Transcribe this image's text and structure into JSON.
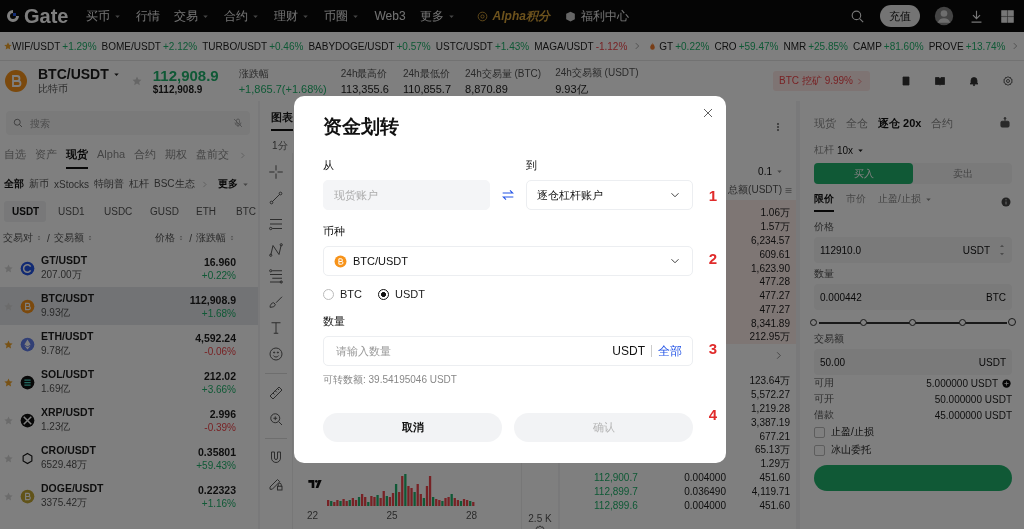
{
  "nav": {
    "logo": "Gate",
    "menu": [
      {
        "label": "买币",
        "dropdown": true,
        "kind": "plain"
      },
      {
        "label": "行情",
        "dropdown": false,
        "kind": "plain"
      },
      {
        "label": "交易",
        "dropdown": true,
        "kind": "plain"
      },
      {
        "label": "合约",
        "dropdown": true,
        "kind": "plain"
      },
      {
        "label": "理财",
        "dropdown": true,
        "kind": "plain"
      },
      {
        "label": "币圈",
        "dropdown": true,
        "kind": "plain"
      },
      {
        "label": "Web3",
        "dropdown": false,
        "kind": "plain"
      },
      {
        "label": "更多",
        "dropdown": true,
        "kind": "plain"
      },
      {
        "label": "Alpha积分",
        "dropdown": false,
        "kind": "alpha"
      },
      {
        "label": "福利中心",
        "dropdown": false,
        "kind": "gift"
      }
    ],
    "deposit": "充值"
  },
  "ticker": {
    "groups": [
      {
        "kind": "favorites",
        "items": [
          {
            "pair": "WIF/USDT",
            "change": "+1.29%",
            "rising": true
          },
          {
            "pair": "BOME/USDT",
            "change": "+2.12%",
            "rising": true
          },
          {
            "pair": "TURBO/USDT",
            "change": "+0.46%",
            "rising": true
          },
          {
            "pair": "BABYDOGE/USDT",
            "change": "+0.57%",
            "rising": true
          },
          {
            "pair": "USTC/USDT",
            "change": "+1.43%",
            "rising": true
          },
          {
            "pair": "MAGA/USDT",
            "change": "-1.12%",
            "rising": false
          }
        ]
      },
      {
        "kind": "hot",
        "items": [
          {
            "pair": "GT",
            "change": "+0.22%",
            "rising": true
          },
          {
            "pair": "CRO",
            "change": "+59.47%",
            "rising": true
          },
          {
            "pair": "NMR",
            "change": "+25.85%",
            "rising": true
          },
          {
            "pair": "CAMP",
            "change": "+81.60%",
            "rising": true
          },
          {
            "pair": "PROVE",
            "change": "+13.74%",
            "rising": true
          }
        ]
      }
    ]
  },
  "pair": {
    "symbol": "BTC/USDT",
    "name": "比特币",
    "price": "112,908.9",
    "price_usd": "$112,908.9",
    "rising": true,
    "promo": "BTC 挖矿 9.99%",
    "stats": [
      {
        "label": "涨跌幅",
        "value": "+1,865.7(+1.68%)",
        "rising": true
      },
      {
        "label": "24h最高价",
        "value": "113,355.6"
      },
      {
        "label": "24h最低价",
        "value": "110,855.7"
      },
      {
        "label": "24h交易量 (BTC)",
        "value": "8,870.89"
      },
      {
        "label": "24h交易额 (USDT)",
        "value": "9.93亿"
      }
    ]
  },
  "market": {
    "search": {
      "placeholder": "搜索"
    },
    "tabs": [
      {
        "label": "自选",
        "selected": false
      },
      {
        "label": "资产",
        "selected": false
      },
      {
        "label": "现货",
        "selected": true
      },
      {
        "label": "Alpha",
        "selected": false
      },
      {
        "label": "合约",
        "selected": false
      },
      {
        "label": "期权",
        "selected": false
      },
      {
        "label": "盘前交",
        "selected": false
      }
    ],
    "filters": [
      {
        "label": "全部",
        "selected": true
      },
      {
        "label": "新币",
        "selected": false
      },
      {
        "label": "xStocks",
        "selected": false
      },
      {
        "label": "特朗普",
        "selected": false
      },
      {
        "label": "杠杆",
        "selected": false
      },
      {
        "label": "BSC生态",
        "selected": false
      }
    ],
    "more": "更多",
    "quotes": [
      {
        "label": "USDT",
        "selected": true
      },
      {
        "label": "USD1",
        "selected": false
      },
      {
        "label": "USDC",
        "selected": false
      },
      {
        "label": "GUSD",
        "selected": false
      },
      {
        "label": "ETH",
        "selected": false
      },
      {
        "label": "BTC",
        "selected": false
      }
    ],
    "columns": {
      "left": [
        "交易对",
        "交易额"
      ],
      "right": [
        "价格",
        "涨跌幅"
      ],
      "separator": "/"
    },
    "rows": [
      {
        "kind": "gt",
        "pair": "GT/USDT",
        "volume": "207.00万",
        "price": "16.960",
        "change": "+0.22%",
        "rising": true,
        "favorite": false,
        "selected": false
      },
      {
        "kind": "btc",
        "pair": "BTC/USDT",
        "volume": "9.93亿",
        "price": "112,908.9",
        "change": "+1.68%",
        "rising": true,
        "favorite": false,
        "selected": true
      },
      {
        "kind": "eth",
        "pair": "ETH/USDT",
        "volume": "9.78亿",
        "price": "4,592.24",
        "change": "-0.06%",
        "rising": false,
        "favorite": true,
        "selected": false
      },
      {
        "kind": "sol",
        "pair": "SOL/USDT",
        "volume": "1.69亿",
        "price": "212.02",
        "change": "+3.66%",
        "rising": true,
        "favorite": true,
        "selected": false
      },
      {
        "kind": "xrp",
        "pair": "XRP/USDT",
        "volume": "1.23亿",
        "price": "2.996",
        "change": "-0.39%",
        "rising": false,
        "favorite": false,
        "selected": false
      },
      {
        "kind": "cro",
        "pair": "CRO/USDT",
        "volume": "6529.48万",
        "price": "0.35801",
        "change": "+59.43%",
        "rising": true,
        "favorite": false,
        "selected": false
      },
      {
        "kind": "doge",
        "pair": "DOGE/USDT",
        "volume": "3375.42万",
        "price": "0.22323",
        "change": "+1.16%",
        "rising": true,
        "favorite": false,
        "selected": false
      }
    ]
  },
  "chart": {
    "tab": "图表",
    "interval": "1分",
    "dates": [
      "22",
      "25",
      "28"
    ],
    "axis_label": "2.5 K"
  },
  "order_book": {
    "precision": "0.1",
    "total_header": "总额(USDT)",
    "asks": [
      {
        "total": "1.06万"
      },
      {
        "total": "1.57万"
      },
      {
        "total": "6,234.57"
      },
      {
        "total": "609.61"
      },
      {
        "total": "1,623.90"
      },
      {
        "total": "477.28"
      },
      {
        "total": "477.27"
      },
      {
        "total": "477.27"
      },
      {
        "total": "8,341.89"
      },
      {
        "total": "212.95万"
      }
    ],
    "bids": [
      {
        "total": "123.64万"
      },
      {
        "total": "5,572.27"
      },
      {
        "total": "1,219.28"
      },
      {
        "total": "3,387.19"
      },
      {
        "total": "677.21"
      },
      {
        "total": "65.13万"
      },
      {
        "total": "1.29万"
      },
      {
        "price": "112,900.7",
        "amount": "0.004000",
        "total": "451.60"
      },
      {
        "price": "112,899.7",
        "amount": "0.036490",
        "total": "4,119.71"
      },
      {
        "price": "112,899.6",
        "amount": "0.004000",
        "total": "451.60"
      }
    ]
  },
  "trade": {
    "margin_tabs": [
      {
        "label": "现货",
        "selected": false
      },
      {
        "label": "全仓",
        "selected": false
      },
      {
        "label": "逐仓 20x",
        "selected": true
      },
      {
        "label": "合约",
        "selected": false
      }
    ],
    "leverage": {
      "label": "杠杆",
      "value": "10x"
    },
    "sides": [
      {
        "label": "买入",
        "kind": "buy",
        "selected": true
      },
      {
        "label": "卖出",
        "kind": "sell",
        "selected": false
      }
    ],
    "order_types": [
      {
        "label": "限价",
        "selected": true,
        "dropdown": false
      },
      {
        "label": "市价",
        "selected": false,
        "dropdown": false
      },
      {
        "label": "止盈/止损",
        "selected": false,
        "dropdown": true
      }
    ],
    "fields": [
      {
        "label": "价格",
        "value": "112910.0",
        "unit": "USDT",
        "stepper": true
      },
      {
        "label": "数量",
        "value": "0.000442",
        "unit": "BTC",
        "stepper": false
      }
    ],
    "slider": {
      "level": 1
    },
    "amount": {
      "label": "交易额",
      "value": "50.00",
      "unit": "USDT"
    },
    "balances": [
      {
        "label": "可用",
        "value": "5.000000 USDT",
        "add": true
      },
      {
        "label": "可开",
        "value": "50.000000 USDT",
        "add": false
      },
      {
        "label": "借款",
        "value": "45.000000 USDT",
        "add": false
      }
    ],
    "options": [
      {
        "label": "止盈/止损",
        "checked": false
      },
      {
        "label": "冰山委托",
        "checked": false
      }
    ]
  },
  "modal": {
    "title": "资金划转",
    "from": {
      "label": "从",
      "value": "现货账户",
      "disabled": true
    },
    "to": {
      "label": "到",
      "value": "逐仓杠杆账户"
    },
    "currency": {
      "label": "币种",
      "value": "BTC/USDT"
    },
    "options": [
      {
        "label": "BTC",
        "selected": false
      },
      {
        "label": "USDT",
        "selected": true
      }
    ],
    "quantity": {
      "label": "数量",
      "placeholder": "请输入数量",
      "unit": "USDT",
      "max": "全部"
    },
    "available": "可转数额: 39.54195046 USDT",
    "buttons": [
      {
        "label": "取消",
        "kind": "cancel",
        "disabled": false
      },
      {
        "label": "确认",
        "kind": "confirm",
        "disabled": true
      }
    ],
    "steps": [
      "1",
      "2",
      "3",
      "4"
    ]
  }
}
